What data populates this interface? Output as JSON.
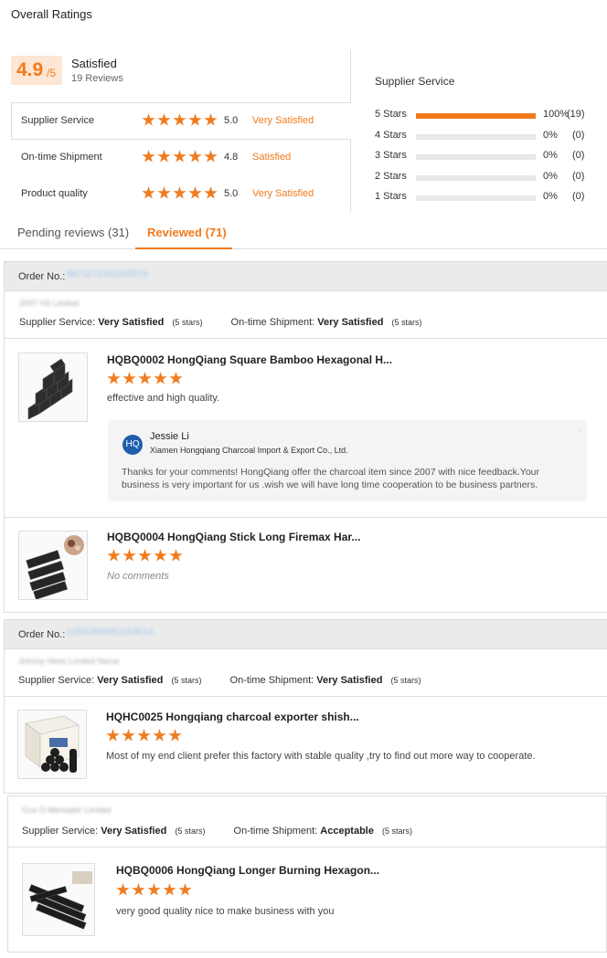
{
  "overall": {
    "title": "Overall Ratings",
    "score": "4.9",
    "score_suffix": "/5",
    "label": "Satisfied",
    "reviews": "19 Reviews"
  },
  "ratings": [
    {
      "name": "Supplier Service",
      "stars": 5,
      "value": "5.0",
      "text": "Very Satisfied"
    },
    {
      "name": "On-time Shipment",
      "stars": 5,
      "value": "4.8",
      "text": "Satisfied"
    },
    {
      "name": "Product quality",
      "stars": 5,
      "value": "5.0",
      "text": "Very Satisfied"
    }
  ],
  "supplier_service": {
    "title": "Supplier Service",
    "bars": [
      {
        "label": "5 Stars",
        "fraction": 1.0,
        "pct": "100%",
        "count": "(19)"
      },
      {
        "label": "4 Stars",
        "fraction": 0,
        "pct": "0%",
        "count": "(0)"
      },
      {
        "label": "3 Stars",
        "fraction": 0,
        "pct": "0%",
        "count": "(0)"
      },
      {
        "label": "2 Stars",
        "fraction": 0,
        "pct": "0%",
        "count": "(0)"
      },
      {
        "label": "1 Stars",
        "fraction": 0,
        "pct": "0%",
        "count": "(0)"
      }
    ]
  },
  "tabs": [
    {
      "label": "Pending reviews (31)",
      "active": false
    },
    {
      "label": "Reviewed (71)",
      "active": true
    }
  ],
  "labels": {
    "order_no": "Order No.:",
    "supplier_service": "Supplier Service:",
    "on_time_shipment": "On-time Shipment:"
  },
  "orders": [
    {
      "order_no": "9871173181918879",
      "buyer": "2007 H3 Limited",
      "supplier_service": "Very Satisfied",
      "supplier_service_stars": "(5 stars)",
      "shipment": "Very Satisfied",
      "shipment_stars": "(5 stars)",
      "products": [
        {
          "name": "HQBQ0002 HongQiang Square Bamboo Hexagonal H...",
          "stars": 5,
          "comment": "effective and high quality.",
          "reply": {
            "name": "Jessie Li",
            "company": "Xiamen Hongqiang Charcoal Import & Export Co., Ltd.",
            "text": "Thanks for your comments! HongQiang offer the charcoal item since 2007 with nice feedback.Your business is very important for us .wish we will have long time cooperation to be business partners."
          }
        },
        {
          "name": "HQBQ0004 HongQiang Stick Long Firemax Har...",
          "stars": 5,
          "comment": "No comments"
        }
      ]
    },
    {
      "order_no": "1356280995118JK14",
      "buyer": "Johnny Hires Limited Name",
      "supplier_service": "Very Satisfied",
      "supplier_service_stars": "(5 stars)",
      "shipment": "Very Satisfied",
      "shipment_stars": "(5 stars)",
      "products": [
        {
          "name": "HQHC0025 Hongqiang charcoal exporter shish...",
          "stars": 5,
          "comment": "Most of my end client prefer this factory with stable quality ,try to find out more way to cooperate."
        }
      ]
    },
    {
      "buyer": "Gus O Merwater Limited",
      "supplier_service": "Very Satisfied",
      "supplier_service_stars": "(5 stars)",
      "shipment": "Acceptable",
      "shipment_stars": "(5 stars)",
      "products": [
        {
          "name": "HQBQ0006 HongQiang Longer Burning Hexagon...",
          "stars": 5,
          "comment": "very good quality nice to make business with you"
        }
      ]
    }
  ],
  "colors": {
    "accent": "#f07b1e",
    "score_bg": "#fde6d4",
    "header_bg": "#ebebeb"
  }
}
